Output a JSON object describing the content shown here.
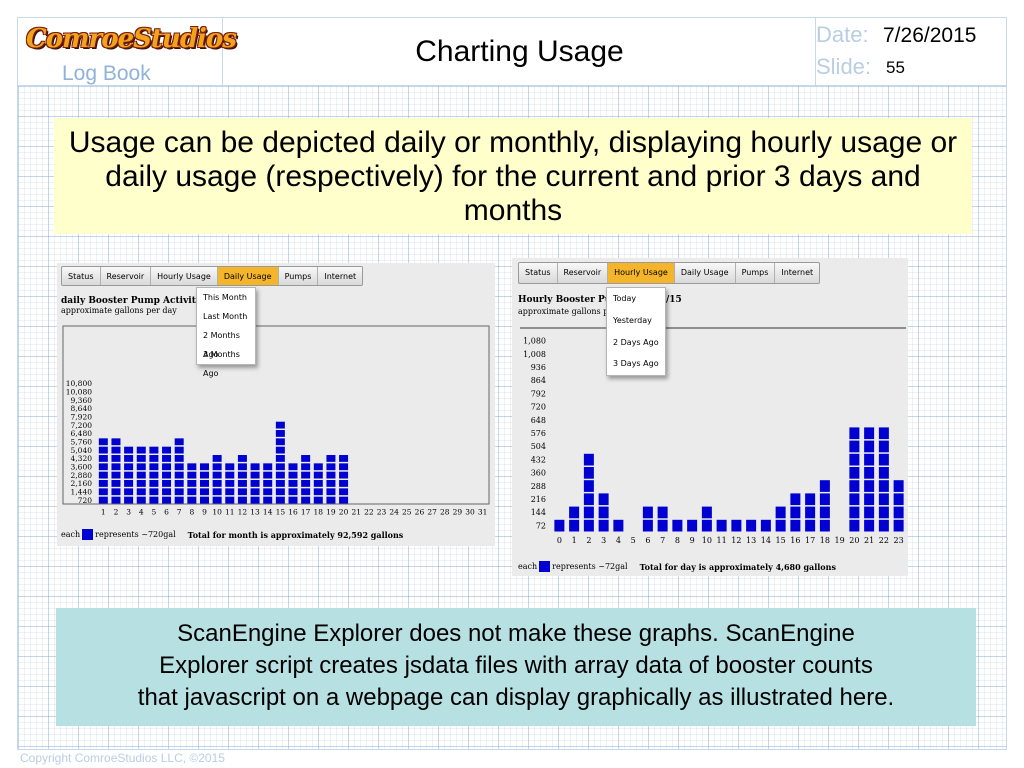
{
  "header": {
    "logo": "ComroeStudios",
    "logbook": "Log Book",
    "title": "Charting Usage",
    "date_label": "Date:",
    "date_value": "7/26/2015",
    "slide_label": "Slide:",
    "slide_value": "55"
  },
  "callout_top": "Usage can be depicted daily or monthly, displaying hourly usage or daily usage (respectively) for the current and prior 3 days and months",
  "callout_bottom": {
    "line1": "ScanEngine Explorer does not make these graphs.  ScanEngine",
    "line2": "Explorer script creates jsdata files with array data of booster counts",
    "line3": "that javascript on a webpage can display graphically as illustrated here."
  },
  "copyright": "Copyright ComroeStudios LLC, ©2015",
  "left_shot": {
    "tabs": [
      "Status",
      "Reservoir",
      "Hourly Usage",
      "Daily Usage",
      "Pumps",
      "Internet"
    ],
    "active_tab": "Daily Usage",
    "menu": [
      "This Month",
      "Last Month",
      "2 Months Ago",
      "3 Months Ago"
    ],
    "title": "daily Booster Pump Activity for Aug",
    "subtitle": "approximate gallons per day",
    "legend_each": "each",
    "legend_represents": "represents ~720gal",
    "total": "Total for month is approximately 92,592 gallons"
  },
  "right_shot": {
    "tabs": [
      "Status",
      "Reservoir",
      "Hourly Usage",
      "Daily Usage",
      "Pumps",
      "Internet"
    ],
    "active_tab": "Hourly Usage",
    "menu": [
      "Today",
      "Yesterday",
      "2 Days Ago",
      "3 Days Ago"
    ],
    "title": "Hourly Booster Pump",
    "title_tail": "/15",
    "subtitle": "approximate gallons pe",
    "legend_each": "each",
    "legend_represents": "represents ~72gal",
    "total": "Total for day is approximately 4,680 gallons"
  },
  "chart_data": [
    {
      "type": "bar",
      "title": "daily Booster Pump Activity for Aug",
      "subtitle": "approximate gallons per day",
      "categories": [
        "1",
        "2",
        "3",
        "4",
        "5",
        "6",
        "7",
        "8",
        "9",
        "10",
        "11",
        "12",
        "13",
        "14",
        "15",
        "16",
        "17",
        "18",
        "19",
        "20",
        "21",
        "22",
        "23",
        "24",
        "25",
        "26",
        "27",
        "28",
        "29",
        "30",
        "31"
      ],
      "values": [
        5760,
        5760,
        5040,
        5040,
        5040,
        5040,
        5760,
        3600,
        3600,
        4320,
        3600,
        4320,
        3600,
        3600,
        7200,
        3600,
        4320,
        3600,
        4320,
        4320,
        0,
        0,
        0,
        0,
        0,
        0,
        0,
        0,
        0,
        0,
        0
      ],
      "ylim": [
        0,
        10800
      ],
      "yticks": [
        "10,800",
        "10,080",
        "9,360",
        "8,640",
        "7,920",
        "7,200",
        "6,480",
        "5,760",
        "5,040",
        "4,320",
        "3,600",
        "2,880",
        "2,160",
        "1,440",
        "720"
      ],
      "unit_per_block": 720,
      "bar_color": "#0000d0"
    },
    {
      "type": "bar",
      "title": "Hourly Booster Pump",
      "subtitle": "approximate gallons pe",
      "categories": [
        "0",
        "1",
        "2",
        "3",
        "4",
        "5",
        "6",
        "7",
        "8",
        "9",
        "10",
        "11",
        "12",
        "13",
        "14",
        "15",
        "16",
        "17",
        "18",
        "19",
        "20",
        "21",
        "22",
        "23"
      ],
      "values": [
        72,
        144,
        432,
        216,
        72,
        0,
        144,
        144,
        72,
        72,
        144,
        72,
        72,
        72,
        72,
        144,
        216,
        216,
        288,
        0,
        576,
        576,
        576,
        288
      ],
      "ylim": [
        0,
        1080
      ],
      "yticks": [
        "1,080",
        "1,008",
        "936",
        "864",
        "792",
        "720",
        "648",
        "576",
        "504",
        "432",
        "360",
        "288",
        "216",
        "144",
        "72"
      ],
      "unit_per_block": 72,
      "bar_color": "#0000d0"
    }
  ]
}
